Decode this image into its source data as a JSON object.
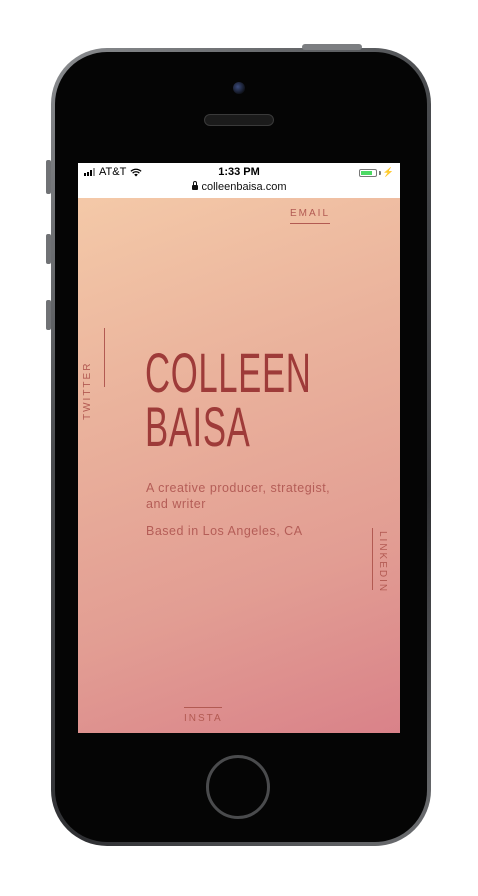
{
  "status_bar": {
    "carrier": "AT&T",
    "time": "1:33 PM"
  },
  "browser": {
    "url": "colleenbaisa.com"
  },
  "site": {
    "nav": {
      "email": "EMAIL",
      "twitter": "TWITTER",
      "linkedin": "LINKEDIN",
      "insta": "INSTA"
    },
    "name_line1": "COLLEEN",
    "name_line2": "BAISA",
    "tagline": "A creative producer, strategist, and writer",
    "location": "Based in Los Angeles, CA"
  },
  "icons": {
    "signal": "signal-bars-icon",
    "wifi": "wifi-icon",
    "lock": "lock-icon",
    "battery": "battery-icon",
    "charging": "charging-bolt-icon"
  },
  "colors": {
    "accent": "#9e3b39",
    "link": "#b25a52",
    "gradient_top": "#f4c9a8",
    "gradient_bottom": "#d98289",
    "battery": "#4cd964"
  }
}
